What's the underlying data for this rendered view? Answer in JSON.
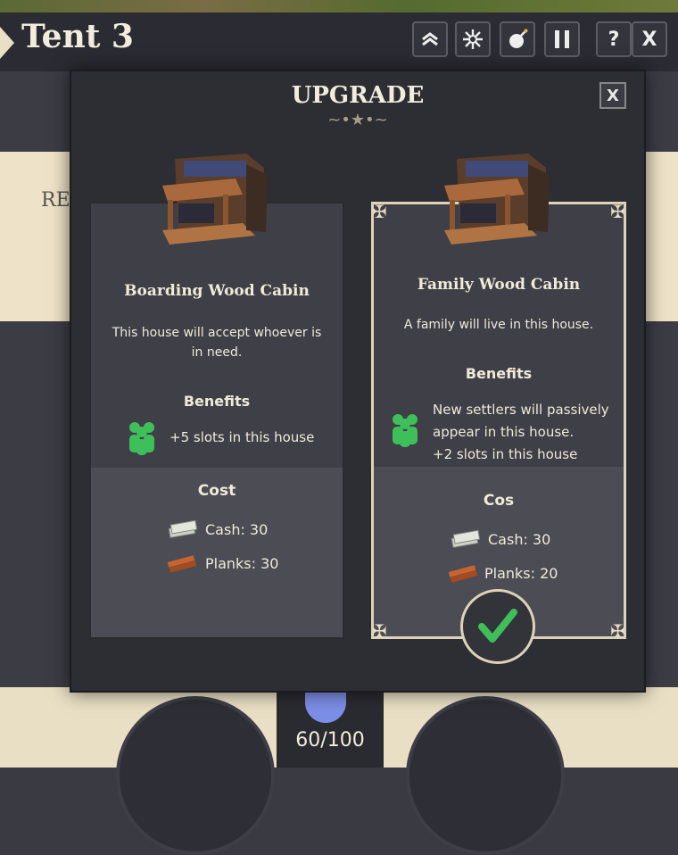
{
  "header": {
    "title": "Tent 3"
  },
  "toolbar": {
    "help_label": "?",
    "close_label": "X",
    "pause_label": "II"
  },
  "background": {
    "left_panel_text": "RE",
    "population": "60/100"
  },
  "modal": {
    "title": "UPGRADE",
    "close_label": "X",
    "options": [
      {
        "name": "Boarding Wood Cabin",
        "description": "This house will accept whoever is in need.",
        "benefits_label": "Benefits",
        "benefit": "+5 slots in this house",
        "cost_label": "Cost",
        "cash": "Cash: 30",
        "planks": "Planks: 30",
        "selected": false
      },
      {
        "name": "Family Wood Cabin",
        "description": "A family will live in this house.",
        "benefits_label": "Benefits",
        "benefit_lines": [
          "New settlers will passively",
          "appear in this house.",
          "+2 slots in this house"
        ],
        "cost_label": "Cos",
        "cash": "Cash: 30",
        "planks": "Planks: 20",
        "selected": true
      }
    ]
  },
  "icons": {
    "toolbar": [
      "upgrade-chevrons-icon",
      "sunburst-icon",
      "bomb-icon",
      "pause-icon",
      "help-icon",
      "close-icon"
    ],
    "benefit": "people-icon",
    "cash": "cash-stack-icon",
    "planks": "planks-icon",
    "confirm": "checkmark-icon"
  },
  "colors": {
    "accent_green": "#3fbf5a",
    "panel": "#3f3f47",
    "cream": "#e9dfc4"
  }
}
